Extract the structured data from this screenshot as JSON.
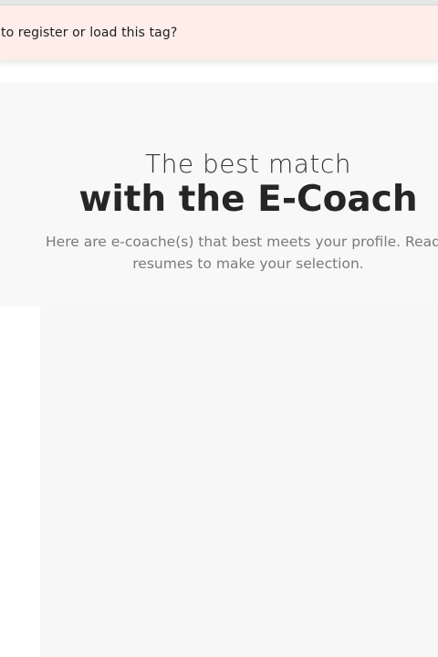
{
  "notice": {
    "text": "to register or load this tag?"
  },
  "hero": {
    "subtitle": "The best match",
    "title": "with the E-Coach",
    "description_line1": "Here are e-coache(s) that best meets your profile. Read t",
    "description_line2": "resumes to make your selection."
  },
  "colors": {
    "notice_background": "#fdeeea",
    "hero_background": "#f8f8f8",
    "title_text": "#262626",
    "description_text": "#7a7a7a"
  }
}
